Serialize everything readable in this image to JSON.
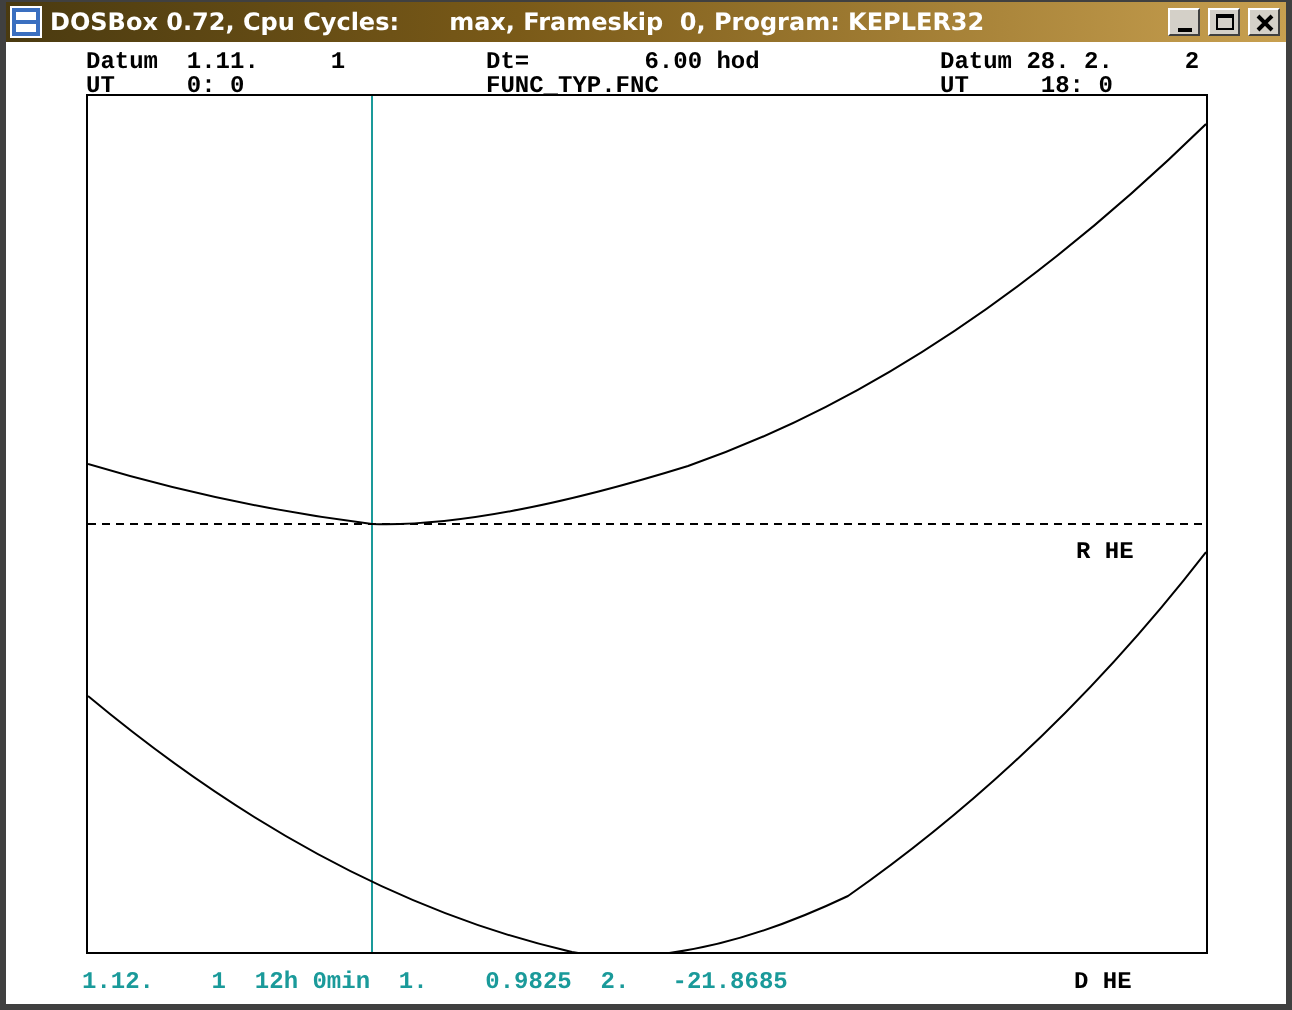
{
  "window": {
    "title": "DOSBox 0.72, Cpu Cycles:      max, Frameskip  0, Program: KEPLER32"
  },
  "header": {
    "left": [
      "Datum  1.11.     1",
      "UT     0: 0"
    ],
    "center": [
      "Dt=        6.00 hod",
      "FUNC_TYP.FNC"
    ],
    "right": [
      "Datum 28. 2.     2",
      "UT     18: 0"
    ]
  },
  "plot": {
    "upper_label": "R HE",
    "lower_label": "D HE"
  },
  "footer": {
    "readout": "1.12.    1  12h 0min  1.    0.9825  2.   -21.8685"
  }
}
